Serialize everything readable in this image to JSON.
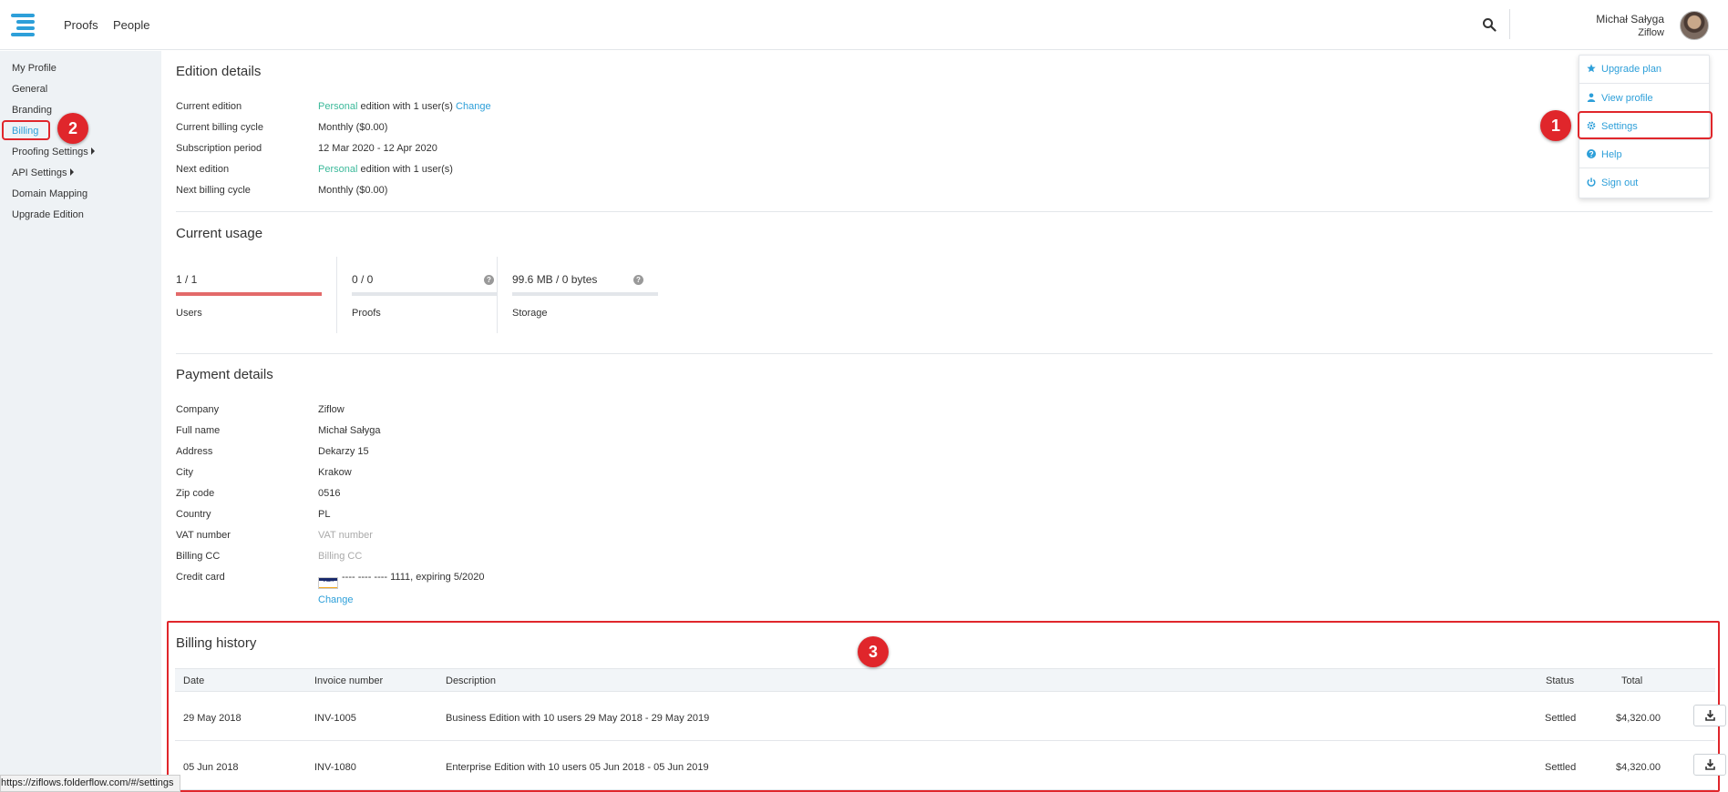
{
  "nav": {
    "proofs": "Proofs",
    "people": "People"
  },
  "user": {
    "name": "Michał Sałyga",
    "company": "Ziflow"
  },
  "sidebar": {
    "items": [
      {
        "label": "My Profile"
      },
      {
        "label": "General"
      },
      {
        "label": "Branding"
      },
      {
        "label": "Billing"
      },
      {
        "label": "Proofing Settings"
      },
      {
        "label": "API Settings"
      },
      {
        "label": "Domain Mapping"
      },
      {
        "label": "Upgrade Edition"
      }
    ]
  },
  "edition": {
    "title": "Edition details",
    "current_edition_label": "Current edition",
    "current_edition_name": "Personal",
    "current_edition_suffix": " edition with 1 user(s) ",
    "change": "Change",
    "billing_cycle_label": "Current billing cycle",
    "billing_cycle_value": "Monthly ($0.00)",
    "subscription_label": "Subscription period",
    "subscription_value": "12 Mar 2020 - 12 Apr 2020",
    "next_edition_label": "Next edition",
    "next_edition_name": "Personal",
    "next_edition_suffix": " edition with 1 user(s)",
    "next_cycle_label": "Next billing cycle",
    "next_cycle_value": "Monthly ($0.00)"
  },
  "usage": {
    "title": "Current usage",
    "users": {
      "value": "1 / 1",
      "label": "Users",
      "fraction": 1.0
    },
    "proofs": {
      "value": "0 / 0",
      "label": "Proofs",
      "fraction": 0.0
    },
    "storage": {
      "value": "99.6 MB / 0 bytes",
      "label": "Storage",
      "fraction": 0.0
    },
    "help_glyph": "?"
  },
  "payment": {
    "title": "Payment details",
    "company_label": "Company",
    "company_value": "Ziflow",
    "fullname_label": "Full name",
    "fullname_value": "Michał Sałyga",
    "address_label": "Address",
    "address_value": "Dekarzy 15",
    "city_label": "City",
    "city_value": "Krakow",
    "zip_label": "Zip code",
    "zip_value": "0516",
    "country_label": "Country",
    "country_value": "PL",
    "vat_label": "VAT number",
    "vat_value": "VAT number",
    "billingcc_label": "Billing CC",
    "billingcc_value": "Billing CC",
    "card_label": "Credit card",
    "card_brand": "VISA",
    "card_value": "---- ---- ---- 1111, expiring 5/2020",
    "change": "Change"
  },
  "history": {
    "title": "Billing history",
    "columns": {
      "date": "Date",
      "invoice": "Invoice number",
      "description": "Description",
      "status": "Status",
      "total": "Total"
    },
    "rows": [
      {
        "date": "29 May 2018",
        "invoice": "INV-1005",
        "description": "Business Edition with 10 users 29 May 2018 - 29 May 2019",
        "status": "Settled",
        "total": "$4,320.00"
      },
      {
        "date": "05 Jun 2018",
        "invoice": "INV-1080",
        "description": "Enterprise Edition with 10 users 05 Jun 2018 - 05 Jun 2019",
        "status": "Settled",
        "total": "$4,320.00"
      }
    ]
  },
  "dropdown": {
    "upgrade": "Upgrade plan",
    "profile": "View profile",
    "settings": "Settings",
    "help": "Help",
    "signout": "Sign out"
  },
  "annotations": {
    "one": "1",
    "two": "2",
    "three": "3"
  },
  "statusbar": "https://ziflows.folderflow.com/#/settings",
  "colors": {
    "accent": "#2d9fd9",
    "green": "#3bb99a",
    "highlight": "#e0262b",
    "usage_fill": "#e36a6a"
  }
}
